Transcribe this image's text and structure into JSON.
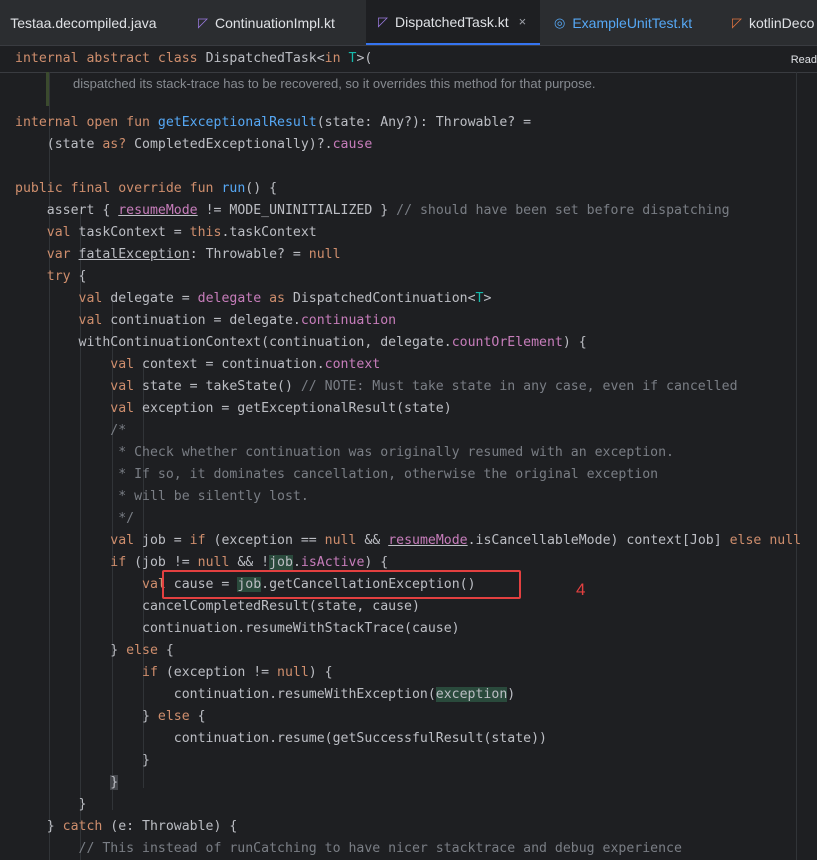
{
  "tabs": [
    {
      "label": "Testaa.decompiled.java",
      "icon": "java-file-icon"
    },
    {
      "label": "ContinuationImpl.kt",
      "icon": "kotlin-file-icon"
    },
    {
      "label": "DispatchedTask.kt",
      "icon": "kotlin-file-icon",
      "active": true,
      "close": "×"
    },
    {
      "label": "ExampleUnitTest.kt",
      "icon": "kotlin-test-file-icon"
    },
    {
      "label": "kotlinDeco",
      "icon": "kotlin-file-icon"
    }
  ],
  "sticky": {
    "kw1": "internal abstract class ",
    "name": "DispatchedTask<",
    "kw2": "in ",
    "type": "T",
    "rest": ">(",
    "reader": "Read"
  },
  "doc_comment": "dispatched its stack-trace has to be recovered, so it overrides this method for that purpose.",
  "code": {
    "l1a": "internal open fun ",
    "l1b": "getExceptionalResult",
    "l1c": "(state: Any?): Throwable? =",
    "l2a": "    (state ",
    "l2b": "as?",
    "l2c": " CompletedExceptionally)?.",
    "l2d": "cause",
    "l3a": "public final override fun ",
    "l3b": "run",
    "l3c": "() {",
    "l4a": "    assert { ",
    "l4b": "resumeMode",
    "l4c": " != MODE_UNINITIALIZED } ",
    "l4d": "// should have been set before dispatching",
    "l5a": "    val",
    "l5b": " taskContext = ",
    "l5c": "this",
    "l5d": ".taskContext",
    "l6a": "    var",
    "l6b": " ",
    "l6c": "fatalException",
    "l6d": ": Throwable? = ",
    "l6e": "null",
    "l7a": "    try",
    "l7b": " {",
    "l8a": "        val",
    "l8b": " delegate = ",
    "l8c": "delegate",
    "l8d": " as",
    "l8e": " DispatchedContinuation<",
    "l8f": "T",
    "l8g": ">",
    "l9a": "        val",
    "l9b": " continuation = delegate.",
    "l9c": "continuation",
    "l10a": "        withContinuationContext(continuation, delegate.",
    "l10b": "countOrElement",
    "l10c": ") {",
    "l11a": "            val",
    "l11b": " context = continuation.",
    "l11c": "context",
    "l12a": "            val",
    "l12b": " state = takeState() ",
    "l12c": "// NOTE: Must take state in any case, even if cancelled",
    "l13a": "            val",
    "l13b": " exception = getExceptionalResult(state)",
    "l14": "            /*",
    "l15": "             * Check whether continuation was originally resumed with an exception.",
    "l16": "             * If so, it dominates cancellation, otherwise the original exception",
    "l17": "             * will be silently lost.",
    "l18": "             */",
    "l19a": "            val",
    "l19b": " job = ",
    "l19c": "if",
    "l19d": " (exception == ",
    "l19e": "null",
    "l19f": " && ",
    "l19g": "resumeMode",
    "l19h": ".isCancellableMode) context[Job] ",
    "l19i": "else",
    "l19j": " null",
    "l20a": "            if",
    "l20b": " (",
    "l20c": "job",
    "l20d": " != ",
    "l20e": "null",
    "l20f": " && !",
    "l20g": "job",
    "l20h": ".",
    "l20i": "isActive",
    "l20j": ") {",
    "l21a": "                val",
    "l21b": " cause = ",
    "l21c": "job",
    "l21d": ".getCancellationException()",
    "l22": "                cancelCompletedResult(state, cause)",
    "l23": "                continuation.resumeWithStackTrace(cause)",
    "l24a": "            } ",
    "l24b": "else",
    "l24c": " {",
    "l25a": "                if",
    "l25b": " (exception != ",
    "l25c": "null",
    "l25d": ") {",
    "l26a": "                    continuation.resumeWithException(",
    "l26b": "exception",
    "l26c": ")",
    "l27a": "                } ",
    "l27b": "else",
    "l27c": " {",
    "l28": "                    continuation.resume(getSuccessfulResult(state))",
    "l29": "                }",
    "l30a": "            ",
    "l30b": "}",
    "l31": "        }",
    "l32a": "    } ",
    "l32b": "catch",
    "l32c": " (e: Throwable) {",
    "l33": "        // This instead of runCatching to have nicer stacktrace and debug experience"
  },
  "annotation": "4",
  "colors": {
    "highlight_box": "#e34040",
    "keyword": "#cf8e6d",
    "function": "#56a8f5",
    "comment": "#7a7e85"
  }
}
